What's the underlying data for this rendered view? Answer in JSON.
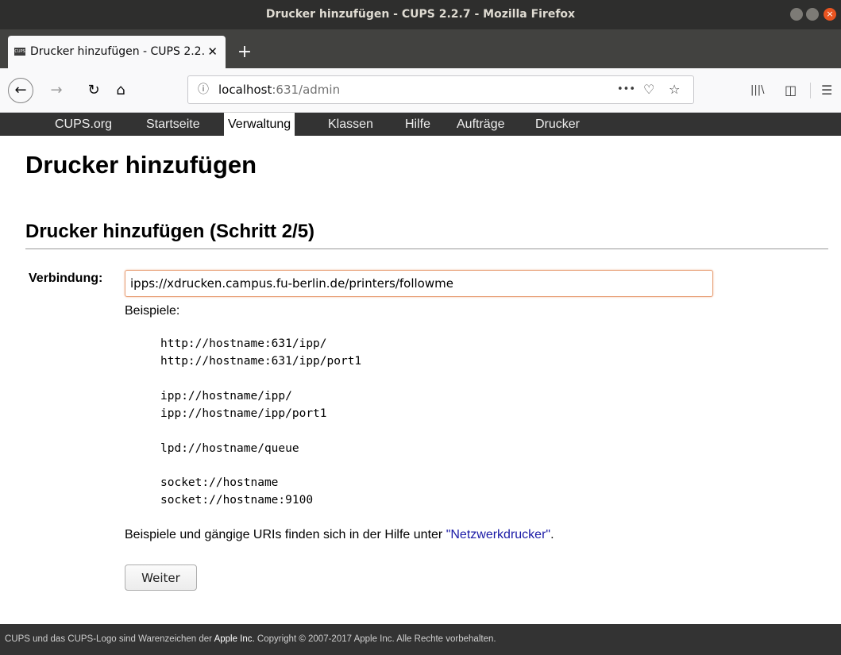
{
  "window": {
    "title": "Drucker hinzufügen - CUPS 2.2.7 - Mozilla Firefox"
  },
  "tab": {
    "favicon_text": "CUPS",
    "title": "Drucker hinzufügen - CUPS 2.2.7",
    "close": "✕",
    "new_tab": "+"
  },
  "url": {
    "info_icon": "ⓘ",
    "host": "localhost",
    "rest": ":631/admin",
    "more": "•••",
    "pocket": "♡",
    "bookmark": "☆"
  },
  "toolbar": {
    "back": "←",
    "forward": "→",
    "reload": "↻",
    "home": "⌂",
    "library": "|||\\",
    "sidebar": "◫",
    "menu": "☰"
  },
  "cups_nav": [
    "CUPS.org",
    "Startseite",
    "Verwaltung",
    "Klassen",
    "Hilfe",
    "Aufträge",
    "Drucker"
  ],
  "page": {
    "title": "Drucker hinzufügen",
    "section_title": "Drucker hinzufügen (Schritt 2/5)",
    "connection_label": "Verbindung:",
    "connection_value": "ipps://xdrucken.campus.fu-berlin.de/printers/followme",
    "examples_label": "Beispiele:",
    "examples": [
      "http://hostname:631/ipp/",
      "http://hostname:631/ipp/port1",
      "ipp://hostname/ipp/",
      "ipp://hostname/ipp/port1",
      "lpd://hostname/queue",
      "socket://hostname",
      "socket://hostname:9100"
    ],
    "info_text": "Beispiele und gängige URIs finden sich in der Hilfe unter ",
    "info_link": "\"Netzwerkdrucker\"",
    "info_end": ".",
    "continue_button": "Weiter"
  },
  "footer": {
    "pre": "CUPS und das CUPS-Logo sind Warenzeichen der ",
    "apple": "Apple Inc.",
    "post": " Copyright © 2007-2017 Apple Inc. Alle Rechte vorbehalten."
  }
}
